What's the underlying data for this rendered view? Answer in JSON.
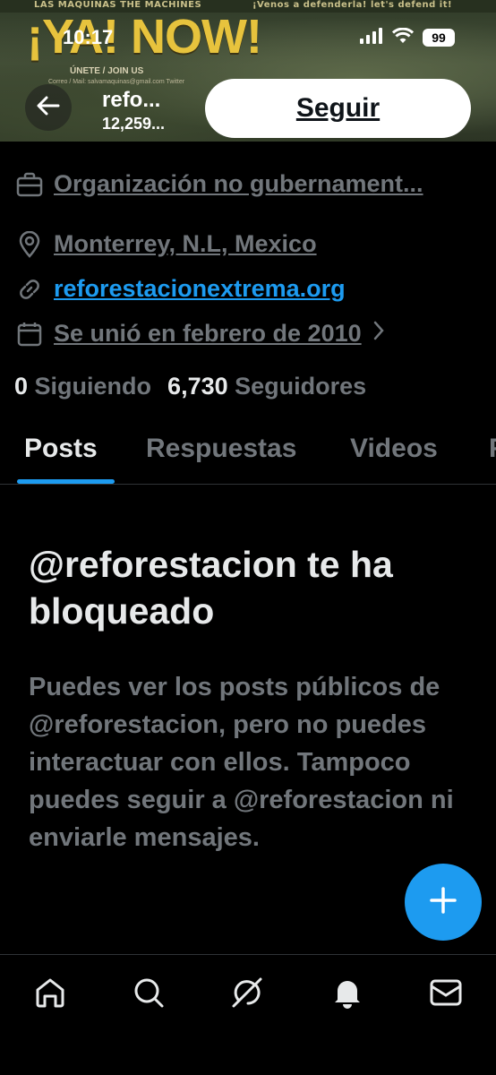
{
  "status_bar": {
    "time": "10:17",
    "battery": "99"
  },
  "banner": {
    "top_left": "LAS MÁQUINAS   THE MACHINES",
    "top_right": "¡Venos a defenderla!  let's defend it!",
    "title": "¡YA! NOW!",
    "subtitle": "ÚNETE / JOIN US",
    "mail": "Correo / Mail: salvamaquinas@gmail.com  Twitter"
  },
  "header": {
    "name": "refo...",
    "post_count": "12,259...",
    "follow_label": "Seguir"
  },
  "profile": {
    "category": "Organización no gubernament...",
    "location": "Monterrey, N.L, Mexico",
    "website": "reforestacionextrema.org",
    "joined": "Se unió en febrero de 2010",
    "following_count": "0",
    "following_label": "Siguiendo",
    "followers_count": "6,730",
    "followers_label": "Seguidores"
  },
  "tabs": [
    "Posts",
    "Respuestas",
    "Videos",
    "F"
  ],
  "blocked": {
    "title": "@reforestacion te ha bloqueado",
    "description": "Puedes ver los posts públicos de @reforestacion, pero no puedes interactuar con ellos. Tampoco puedes seguir a @reforestacion ni enviarle mensajes."
  },
  "colors": {
    "accent": "#1d9bf0",
    "muted": "#71767b",
    "text": "#e7e9ea",
    "background": "#000000"
  },
  "icons": [
    "back-arrow-icon",
    "briefcase-icon",
    "location-pin-icon",
    "link-icon",
    "calendar-icon",
    "chevron-right-icon",
    "plus-icon",
    "home-icon",
    "search-icon",
    "grok-icon",
    "bell-icon",
    "mail-icon"
  ]
}
